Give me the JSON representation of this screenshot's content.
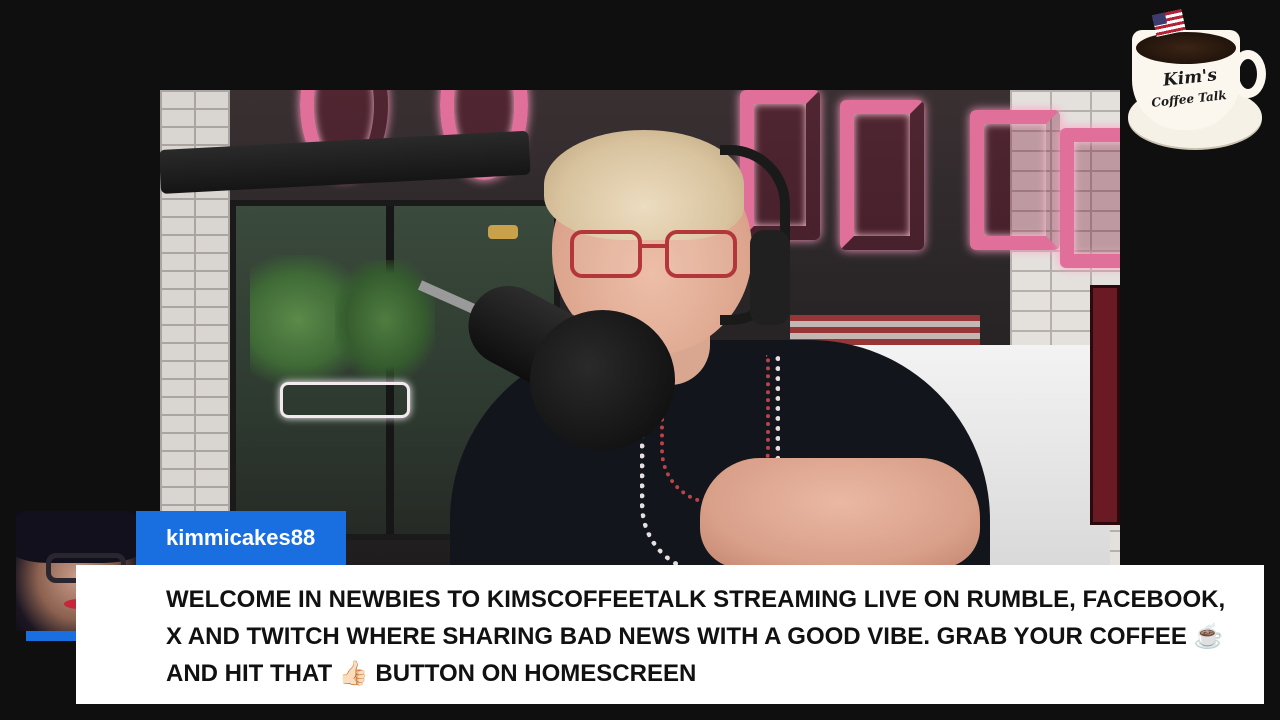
{
  "logo": {
    "line1": "Kim's",
    "line2": "Coffee Talk",
    "flag_icon": "us-flag-icon"
  },
  "chat": {
    "username": "kimmicakes88",
    "message": "WELCOME IN NEWBIES TO KIMSCOFFEETALK STREAMING LIVE ON RUMBLE, FACEBOOK, X AND TWITCH WHERE SHARING BAD NEWS WITH A GOOD VIBE. GRAB YOUR COFFEE ☕ AND HIT THAT 👍🏻 BUTTON ON HOMESCREEN",
    "accent_color": "#1a6fe0"
  },
  "colors": {
    "background": "#0f0f0f",
    "neon": "#e06f9a"
  }
}
